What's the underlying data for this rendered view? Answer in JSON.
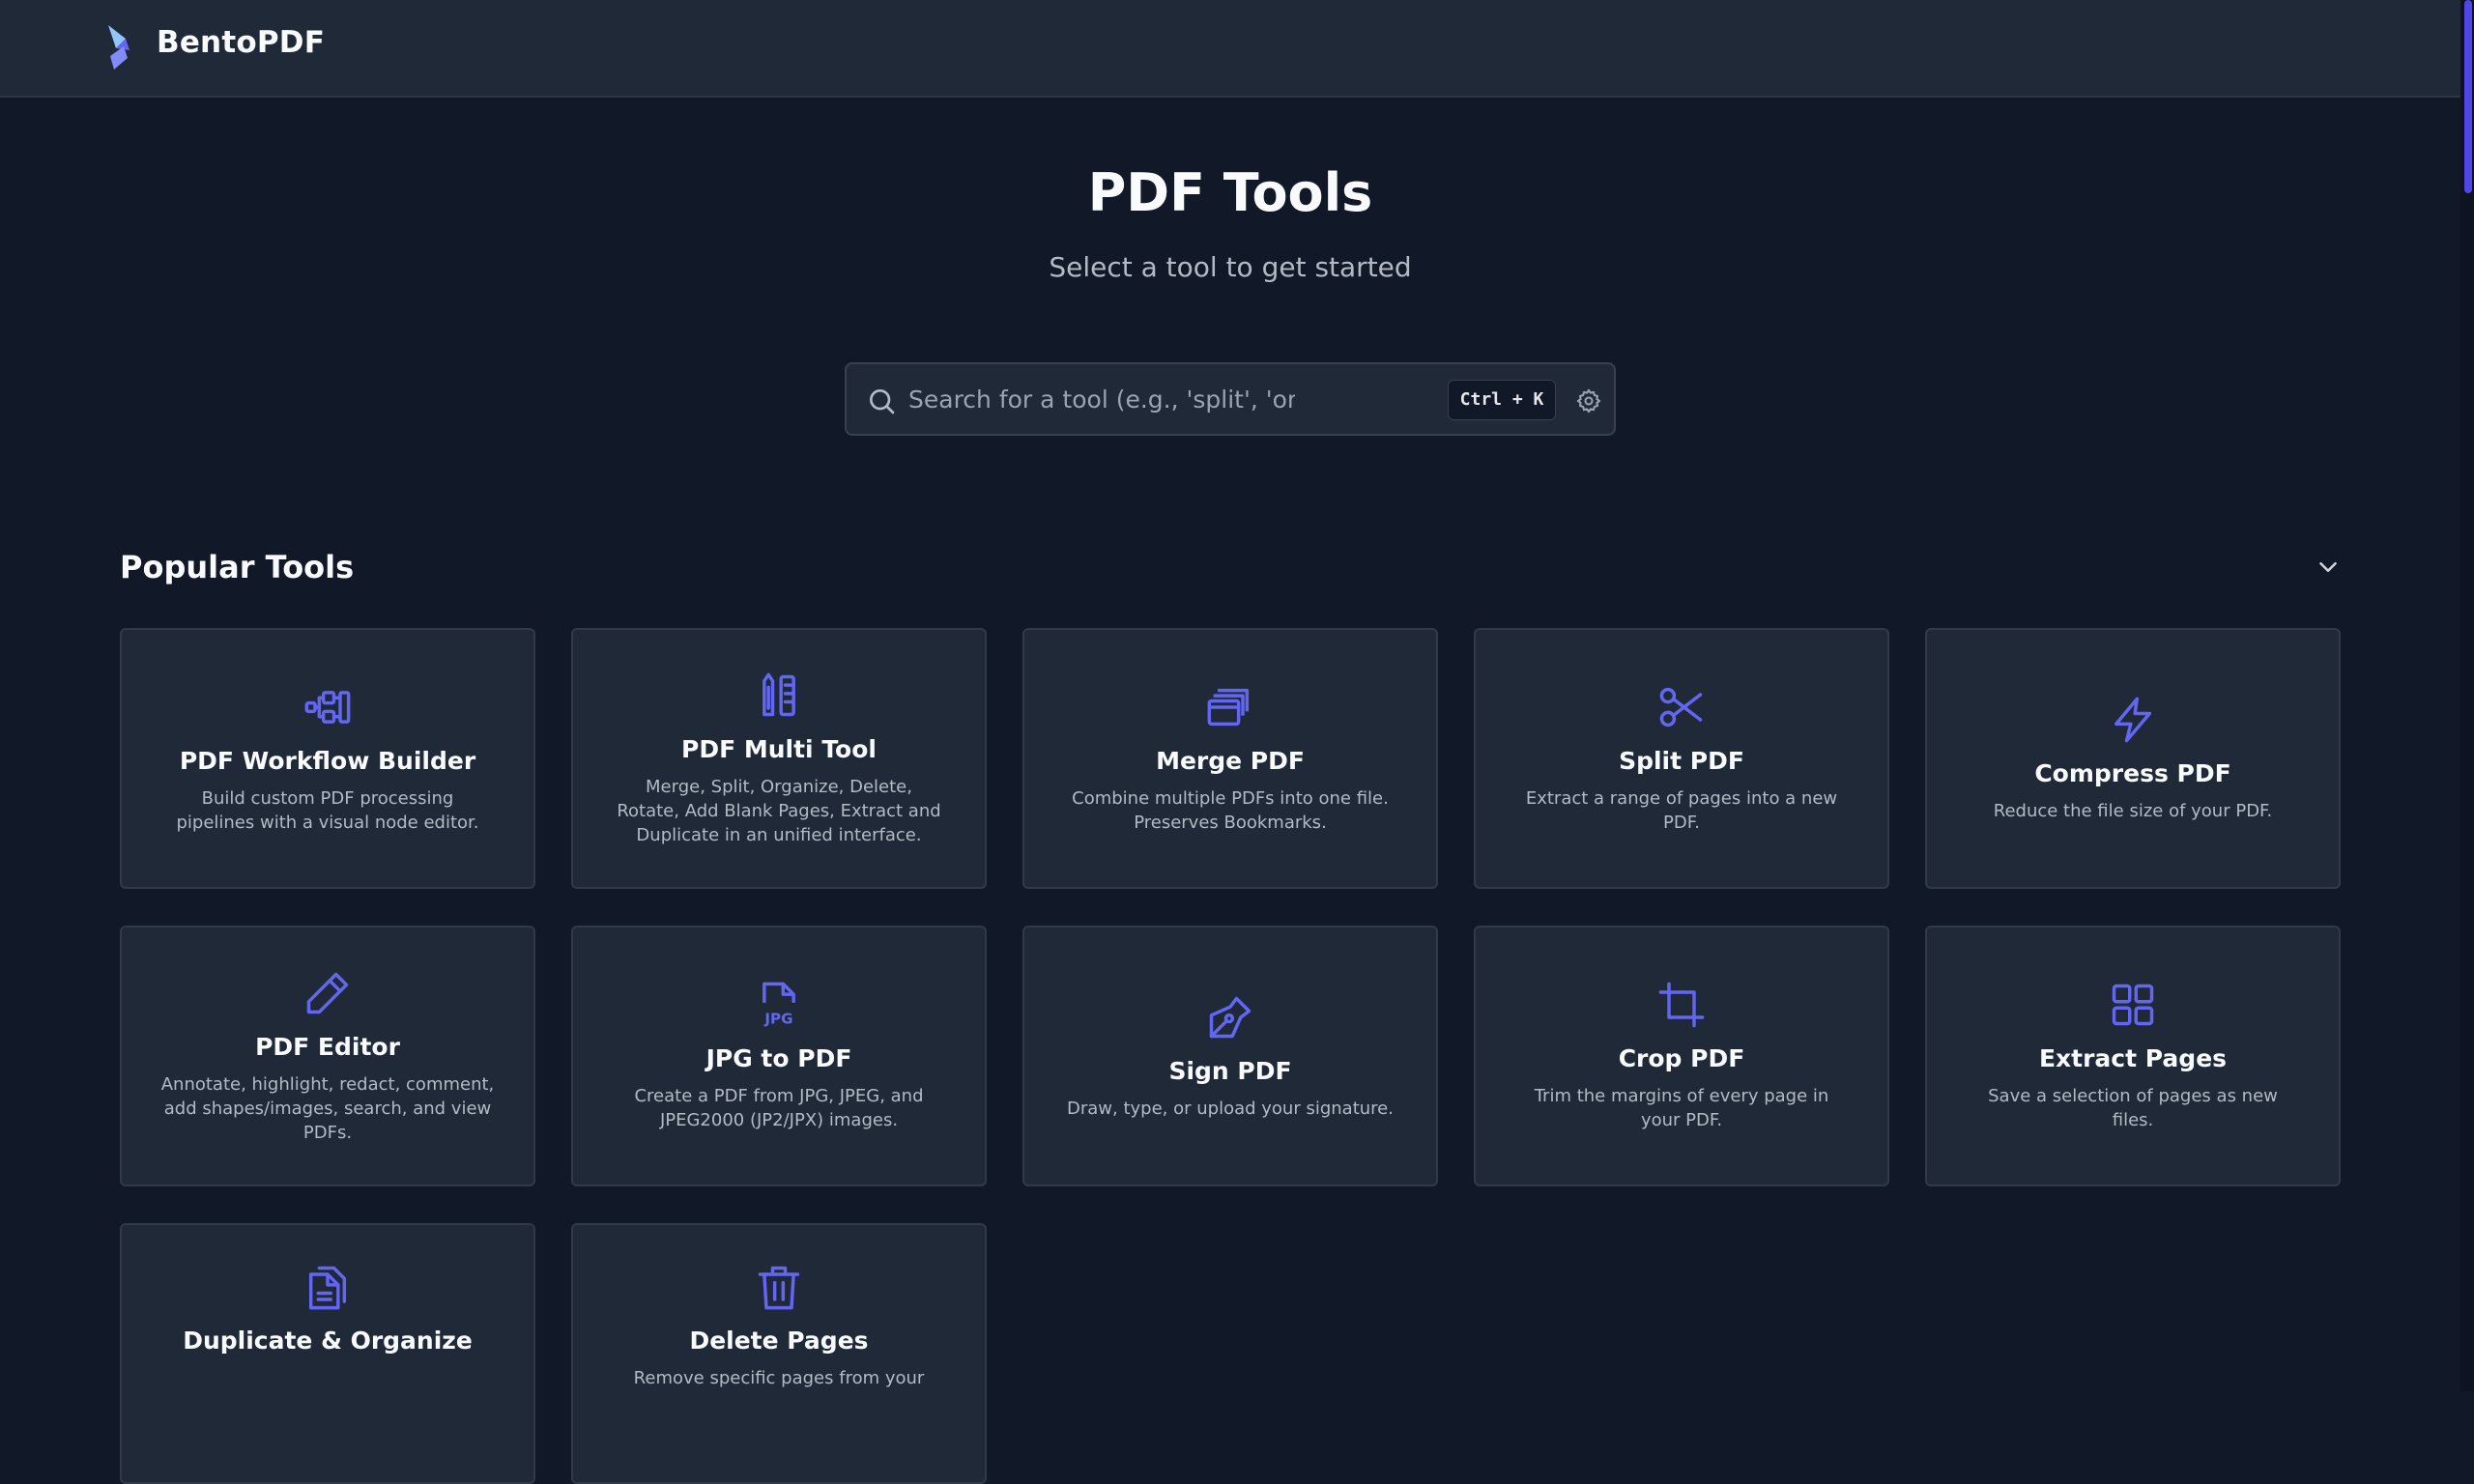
{
  "header": {
    "brand": "BentoPDF"
  },
  "hero": {
    "title": "PDF Tools",
    "subtitle": "Select a tool to get started"
  },
  "search": {
    "placeholder": "Search for a tool (e.g., 'split', 'organize'...)",
    "shortcut": "Ctrl + K"
  },
  "section": {
    "title": "Popular Tools"
  },
  "colors": {
    "background": "#111827",
    "header": "#1f2937",
    "card": "#1f2937",
    "accent": "#6366f1",
    "text": "#f9fafb",
    "muted": "#b3bac6"
  },
  "tools": [
    {
      "icon": "workflow-icon",
      "title": "PDF Workflow Builder",
      "desc": "Build custom PDF processing pipelines with a visual node editor."
    },
    {
      "icon": "multi-tool-icon",
      "title": "PDF Multi Tool",
      "desc": "Merge, Split, Organize, Delete, Rotate, Add Blank Pages, Extract and Duplicate in an unified interface."
    },
    {
      "icon": "merge-icon",
      "title": "Merge PDF",
      "desc": "Combine multiple PDFs into one file. Preserves Bookmarks."
    },
    {
      "icon": "scissors-icon",
      "title": "Split PDF",
      "desc": "Extract a range of pages into a new PDF."
    },
    {
      "icon": "lightning-icon",
      "title": "Compress PDF",
      "desc": "Reduce the file size of your PDF."
    },
    {
      "icon": "pencil-icon",
      "title": "PDF Editor",
      "desc": "Annotate, highlight, redact, comment, add shapes/images, search, and view PDFs."
    },
    {
      "icon": "jpg-file-icon",
      "title": "JPG to PDF",
      "desc": "Create a PDF from JPG, JPEG, and JPEG2000 (JP2/JPX) images."
    },
    {
      "icon": "pen-nib-icon",
      "title": "Sign PDF",
      "desc": "Draw, type, or upload your signature."
    },
    {
      "icon": "crop-icon",
      "title": "Crop PDF",
      "desc": "Trim the margins of every page in your PDF."
    },
    {
      "icon": "grid-icon",
      "title": "Extract Pages",
      "desc": "Save a selection of pages as new files."
    },
    {
      "icon": "duplicate-icon",
      "title": "Duplicate & Organize",
      "desc": ""
    },
    {
      "icon": "trash-icon",
      "title": "Delete Pages",
      "desc": "Remove specific pages from your"
    }
  ]
}
